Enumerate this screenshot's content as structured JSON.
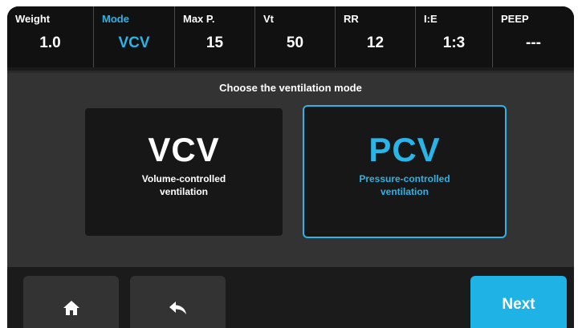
{
  "header": {
    "params": [
      {
        "label": "Weight",
        "value": "1.0",
        "active": false
      },
      {
        "label": "Mode",
        "value": "VCV",
        "active": true
      },
      {
        "label": "Max P.",
        "value": "15",
        "active": false
      },
      {
        "label": "Vt",
        "value": "50",
        "active": false
      },
      {
        "label": "RR",
        "value": "12",
        "active": false
      },
      {
        "label": "I:E",
        "value": "1:3",
        "active": false
      },
      {
        "label": "PEEP",
        "value": "---",
        "active": false
      }
    ]
  },
  "main": {
    "prompt": "Choose the ventilation mode",
    "modes": [
      {
        "name": "VCV",
        "description": "Volume-controlled ventilation",
        "selected": false
      },
      {
        "name": "PCV",
        "description": "Pressure-controlled ventilation",
        "selected": true
      }
    ]
  },
  "footer": {
    "home_icon": "home-icon",
    "back_icon": "back-arrow-icon",
    "next_label": "Next"
  },
  "colors": {
    "accent": "#2ab4e8",
    "next_button": "#1fb2e5",
    "background": "#1b1b1b",
    "panel": "#333333"
  }
}
